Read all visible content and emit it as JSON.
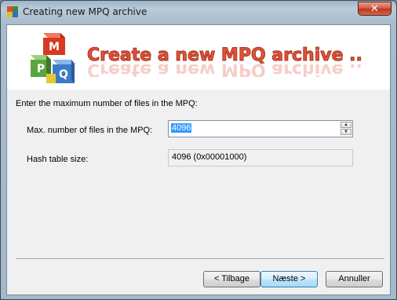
{
  "window": {
    "title": "Creating new MPQ archive",
    "close_glyph": "✕"
  },
  "banner": {
    "heading": "Create a new MPQ archive ..",
    "logo_letters": [
      "M",
      "P",
      "Q"
    ]
  },
  "form": {
    "intro": "Enter the maximum number of files in the MPQ:",
    "max_files_label": "Max. number of files in the MPQ:",
    "max_files_value": "4096",
    "hash_label": "Hash table size:",
    "hash_value": "4096 (0x00001000)"
  },
  "buttons": {
    "back": "< Tilbage",
    "next": "Næste >",
    "cancel": "Annuller"
  },
  "icons": [
    "app-icon",
    "close-icon",
    "mpq-cube-logo",
    "spin-up-icon",
    "spin-down-icon"
  ]
}
